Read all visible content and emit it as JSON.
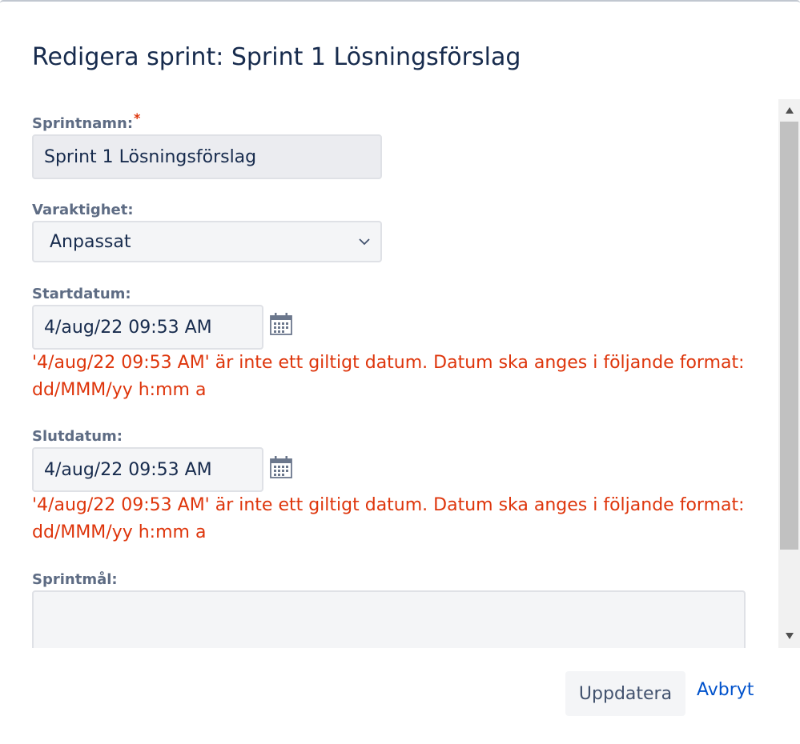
{
  "dialog": {
    "title": "Redigera sprint: Sprint 1 Lösningsförslag"
  },
  "form": {
    "sprint_name": {
      "label": "Sprintnamn:",
      "required_marker": "*",
      "value": "Sprint 1 Lösningsförslag"
    },
    "duration": {
      "label": "Varaktighet:",
      "value": "Anpassat"
    },
    "start_date": {
      "label": "Startdatum:",
      "value": "4/aug/22 09:53 AM",
      "error": "'4/aug/22 09:53 AM' är inte ett giltigt datum. Datum ska anges i följande format: dd/MMM/yy h:mm a"
    },
    "end_date": {
      "label": "Slutdatum:",
      "value": "4/aug/22 09:53 AM",
      "error": "'4/aug/22 09:53 AM' är inte ett giltigt datum. Datum ska anges i följande format: dd/MMM/yy h:mm a"
    },
    "sprint_goal": {
      "label": "Sprintmål:",
      "value": ""
    }
  },
  "footer": {
    "update_label": "Uppdatera",
    "cancel_label": "Avbryt"
  },
  "icons": {
    "calendar": "calendar-icon",
    "select_arrow": "chevron-down-icon",
    "scroll_up": "arrow-up-icon",
    "scroll_down": "arrow-down-icon"
  },
  "colors": {
    "error": "#de350b",
    "link": "#0052cc",
    "label": "#5e6c84",
    "text": "#172b4d",
    "field_bg": "#f4f5f7"
  }
}
